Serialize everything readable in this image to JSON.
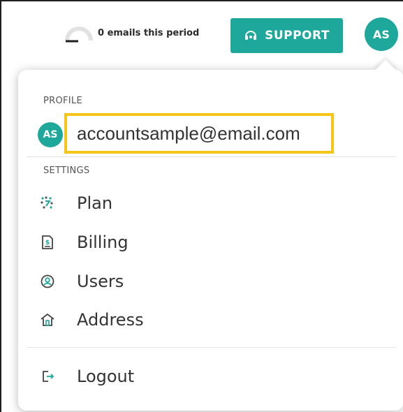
{
  "header": {
    "usage_text": "0 emails this period",
    "support_label": "SUPPORT",
    "avatar_initials": "AS"
  },
  "menu": {
    "profile_label": "PROFILE",
    "avatar_initials": "AS",
    "email": "accountsample@email.com",
    "settings_label": "SETTINGS",
    "items": [
      {
        "label": "Plan",
        "icon": "plan-icon"
      },
      {
        "label": "Billing",
        "icon": "billing-icon"
      },
      {
        "label": "Users",
        "icon": "users-icon"
      },
      {
        "label": "Address",
        "icon": "address-icon"
      }
    ],
    "logout_label": "Logout",
    "logout_icon": "logout-icon"
  },
  "colors": {
    "accent": "#1ea79b",
    "highlight": "#f5c518"
  }
}
